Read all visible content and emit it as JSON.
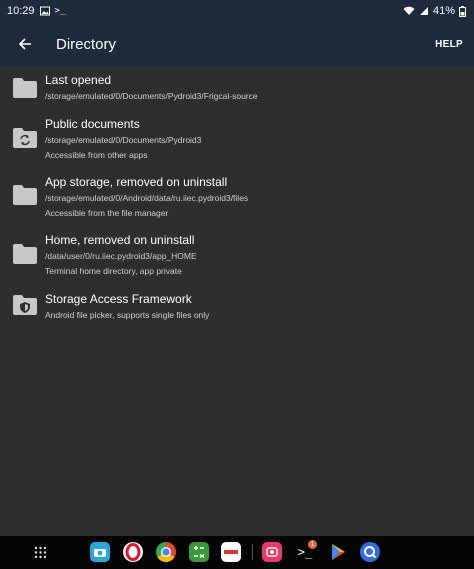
{
  "status_bar": {
    "time": "10:29",
    "battery": "41%"
  },
  "app_bar": {
    "title": "Directory",
    "help_label": "HELP"
  },
  "items": [
    {
      "title": "Last opened",
      "path": "/storage/emulated/0/Documents/Pydroid3/Frigcal-source",
      "desc": "",
      "icon": "folder-icon"
    },
    {
      "title": "Public documents",
      "path": "/storage/emulated/0/Documents/Pydroid3",
      "desc": "Accessible from other apps",
      "icon": "folder-sync-icon"
    },
    {
      "title": "App storage, removed on uninstall",
      "path": "/storage/emulated/0/Android/data/ru.iiec.pydroid3/files",
      "desc": "Accessible from the file manager",
      "icon": "folder-icon"
    },
    {
      "title": "Home, removed on uninstall",
      "path": "/data/user/0/ru.iiec.pydroid3/app_HOME",
      "desc": "Terminal home directory, app private",
      "icon": "folder-icon"
    },
    {
      "title": "Storage Access Framework",
      "path": "",
      "desc": "Android file picker, supports single files only",
      "icon": "folder-shield-icon"
    }
  ],
  "dock": {
    "terminal_badge": "1"
  },
  "colors": {
    "app_bar": "#1d2b3c",
    "background": "#2e2e2e",
    "folder": "#c8c8c8"
  }
}
